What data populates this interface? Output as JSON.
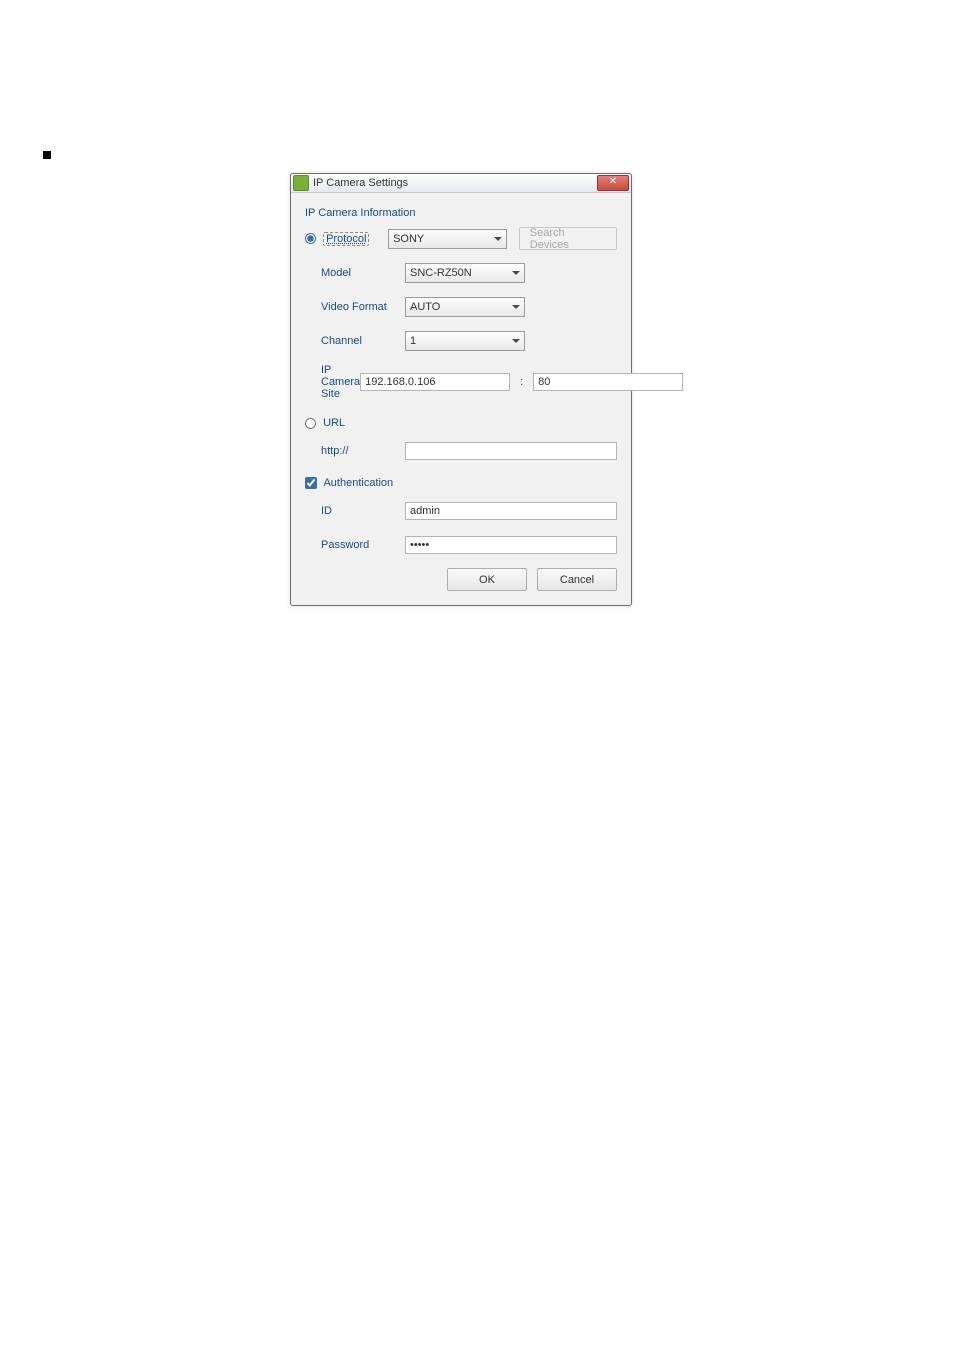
{
  "dialog": {
    "title": "IP Camera Settings",
    "close_glyph": "✕",
    "section_label": "IP Camera Information",
    "protocol": {
      "label": "Protocol",
      "value": "SONY",
      "search_button": "Search Devices"
    },
    "model": {
      "label": "Model",
      "value": "SNC-RZ50N"
    },
    "video_format": {
      "label": "Video Format",
      "value": "AUTO"
    },
    "channel": {
      "label": "Channel",
      "value": "1"
    },
    "site": {
      "label": "IP Camera Site",
      "ip": "192.168.0.106",
      "sep": ":",
      "port": "80"
    },
    "url": {
      "label": "URL",
      "prefix": "http://",
      "value": ""
    },
    "auth": {
      "label": "Authentication",
      "id_label": "ID",
      "id_value": "admin",
      "password_label": "Password",
      "password_value": "•••••"
    },
    "buttons": {
      "ok": "OK",
      "cancel": "Cancel"
    }
  }
}
